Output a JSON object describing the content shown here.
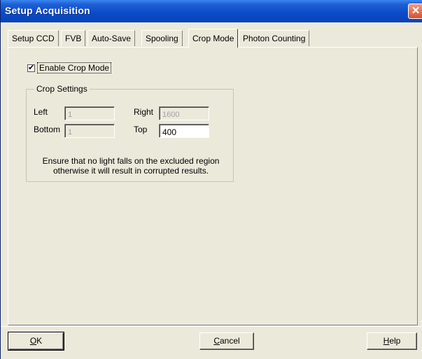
{
  "window": {
    "title": "Setup Acquisition",
    "close_glyph": "✕"
  },
  "tabs": [
    {
      "label": "Setup CCD"
    },
    {
      "label": "FVB"
    },
    {
      "label": "Auto-Save"
    },
    {
      "label": "Spooling"
    },
    {
      "label": "Crop Mode",
      "active": true
    },
    {
      "label": "Photon Counting"
    }
  ],
  "crop": {
    "enable_label": "Enable Crop Mode",
    "enabled": true,
    "check_glyph": "✔",
    "group_title": "Crop Settings",
    "left_label": "Left",
    "left_value": "1",
    "right_label": "Right",
    "right_value": "1600",
    "bottom_label": "Bottom",
    "bottom_value": "1",
    "top_label": "Top",
    "top_value": "400",
    "note": "Ensure that no light falls on the excluded region otherwise it will result in corrupted results."
  },
  "buttons": {
    "ok_underline": "O",
    "ok_rest": "K",
    "cancel_underline": "C",
    "cancel_rest": "ancel",
    "help_underline": "H",
    "help_rest": "elp"
  },
  "colors": {
    "titlebar": "#0a4bc8",
    "face": "#ebe9da",
    "close": "#d8502a"
  }
}
